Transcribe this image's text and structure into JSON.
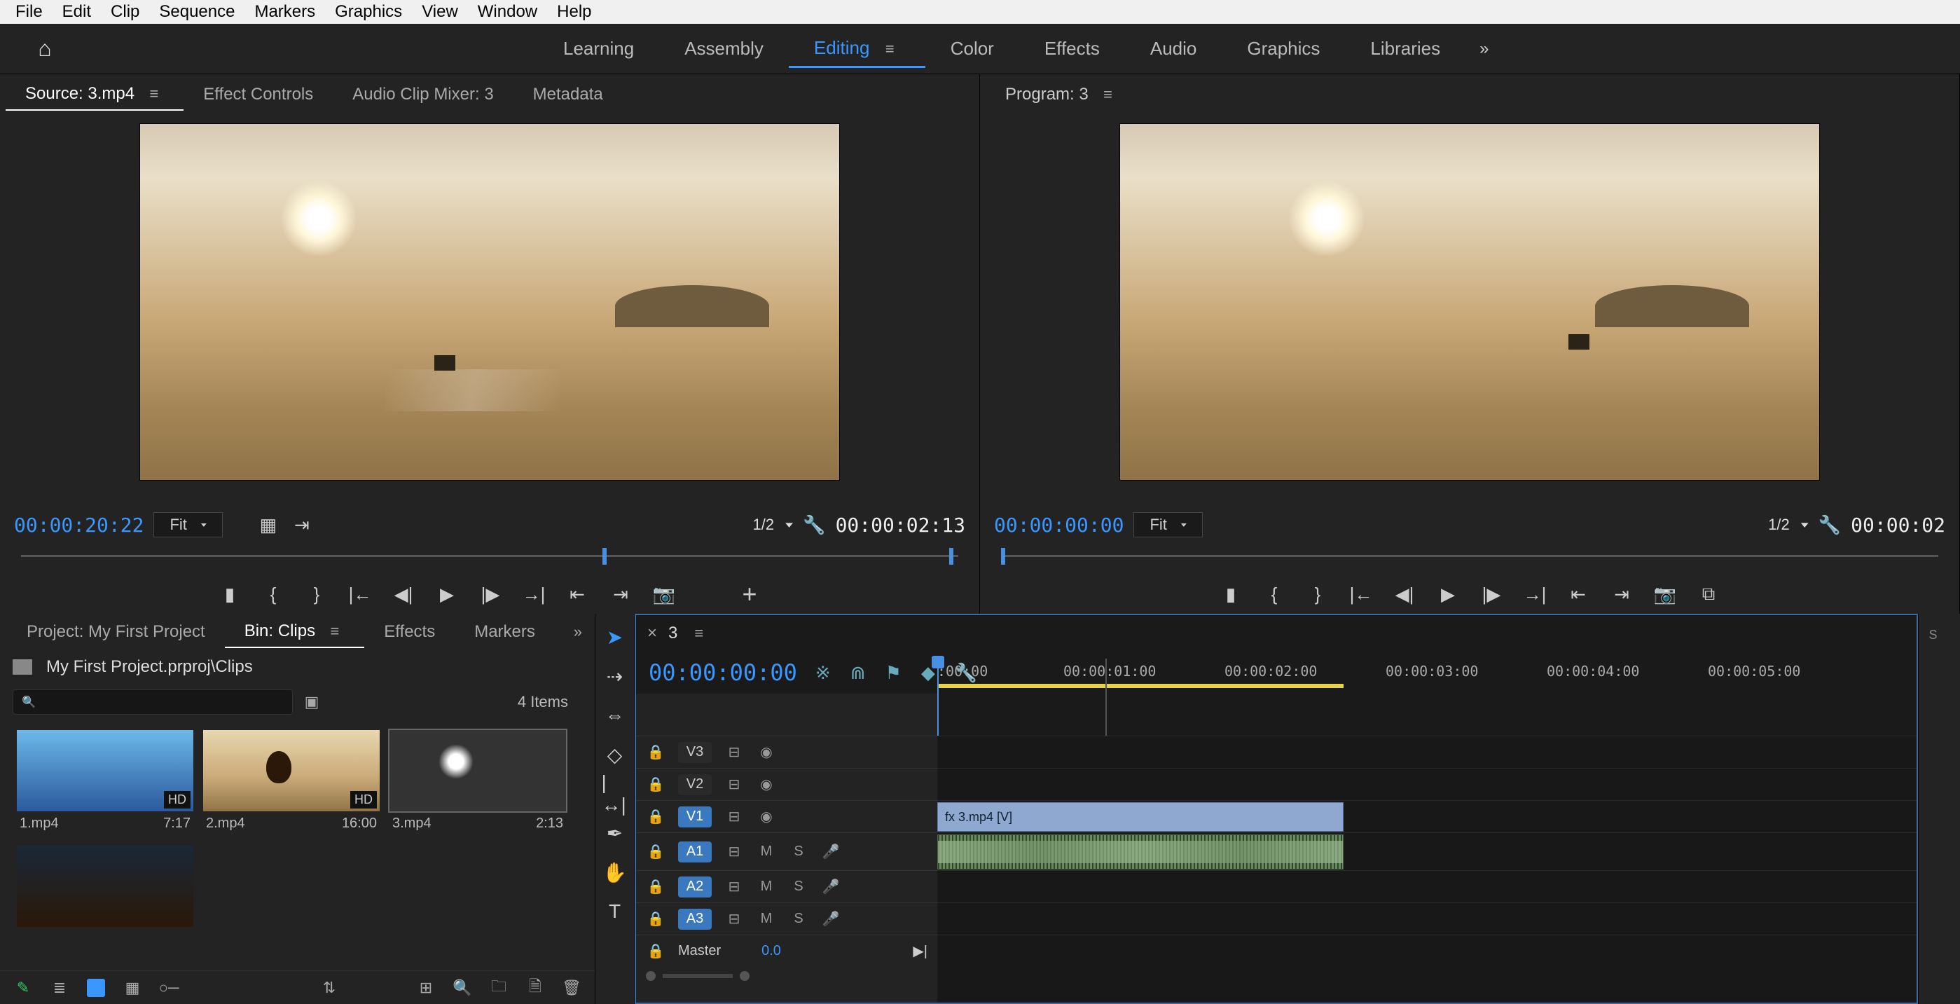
{
  "menubar": [
    "File",
    "Edit",
    "Clip",
    "Sequence",
    "Markers",
    "Graphics",
    "View",
    "Window",
    "Help"
  ],
  "workspaces": {
    "items": [
      "Learning",
      "Assembly",
      "Editing",
      "Color",
      "Effects",
      "Audio",
      "Graphics",
      "Libraries"
    ],
    "active": "Editing"
  },
  "source": {
    "tabs": [
      "Source: 3.mp4",
      "Effect Controls",
      "Audio Clip Mixer: 3",
      "Metadata"
    ],
    "active_tab": "Source: 3.mp4",
    "tc_left": "00:00:20:22",
    "fit": "Fit",
    "res": "1/2",
    "tc_right": "00:00:02:13"
  },
  "program": {
    "title": "Program: 3",
    "tc_left": "00:00:00:00",
    "fit": "Fit",
    "res": "1/2",
    "tc_right": "00:00:02"
  },
  "project": {
    "tabs": [
      "Project: My First Project",
      "Bin: Clips",
      "Effects",
      "Markers"
    ],
    "active_tab": "Bin: Clips",
    "path": "My First Project.prproj\\Clips",
    "items_count": "4 Items",
    "clips": [
      {
        "name": "1.mp4",
        "dur": "7:17",
        "thumb": "t1"
      },
      {
        "name": "2.mp4",
        "dur": "16:00",
        "thumb": "t2"
      },
      {
        "name": "3.mp4",
        "dur": "2:13",
        "thumb": "t3",
        "selected": true
      },
      {
        "name": "",
        "dur": "",
        "thumb": "t4"
      }
    ]
  },
  "timeline": {
    "seq_name": "3",
    "tc": "00:00:00:00",
    "ruler": [
      ":00:00",
      "00:00:01:00",
      "00:00:02:00",
      "00:00:03:00",
      "00:00:04:00",
      "00:00:05:00"
    ],
    "tracks_v": [
      "V3",
      "V2",
      "V1"
    ],
    "tracks_a": [
      "A1",
      "A2",
      "A3"
    ],
    "master_label": "Master",
    "master_val": "0.0",
    "clip_v_label": "3.mp4 [V]"
  },
  "icons": {
    "home": "⌂",
    "overflow": "»",
    "menu": "≡",
    "chev": "▾",
    "wrench": "🔧",
    "search": "🔍",
    "folder": "🗀",
    "play": "▶",
    "step_fwd": "⏭",
    "step_back": "⏮",
    "mark_in": "{",
    "mark_out": "}",
    "marker": "◆",
    "camera": "📷",
    "plus": "+",
    "lock": "🔒",
    "eye": "👁",
    "mic": "🎤"
  }
}
